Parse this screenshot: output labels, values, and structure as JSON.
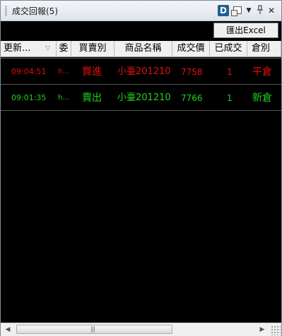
{
  "window": {
    "title": "成交回報(5)"
  },
  "titlebar": {
    "d_logo": "D",
    "dropdown_glyph": "▼",
    "pin_glyph": "ᚁ",
    "close_glyph": "✕"
  },
  "toolbar": {
    "export_label": "匯出Excel"
  },
  "columns": [
    "更新...",
    "委",
    "買賣別",
    "商品名稱",
    "成交價",
    "已成交",
    "倉別"
  ],
  "rows": [
    {
      "time": "09:04:51",
      "order": "h...",
      "side": "買進",
      "product": "小臺201210",
      "price": "7758",
      "filled": "1",
      "position": "平倉",
      "color": "#e01010"
    },
    {
      "time": "09:01:35",
      "order": "h...",
      "side": "賣出",
      "product": "小臺201210",
      "price": "7766",
      "filled": "1",
      "position": "新倉",
      "color": "#20d020"
    }
  ],
  "scrollbar": {
    "left_arrow": "◀",
    "right_arrow": "▶",
    "grip": "|||"
  }
}
